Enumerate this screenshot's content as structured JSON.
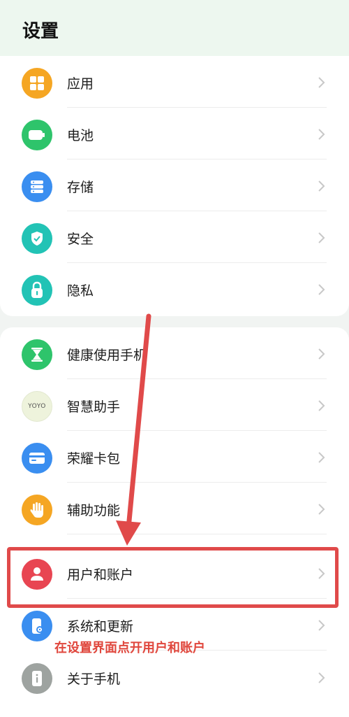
{
  "header": {
    "title": "设置"
  },
  "groups": [
    {
      "items": [
        {
          "label": "应用",
          "icon": "apps-grid-icon",
          "color": "#f5a623"
        },
        {
          "label": "电池",
          "icon": "battery-icon",
          "color": "#2ec46b"
        },
        {
          "label": "存储",
          "icon": "storage-icon",
          "color": "#3a8ef0"
        },
        {
          "label": "安全",
          "icon": "shield-check-icon",
          "color": "#22c3b5"
        },
        {
          "label": "隐私",
          "icon": "privacy-lock-icon",
          "color": "#22c3b5"
        }
      ]
    },
    {
      "items": [
        {
          "label": "健康使用手机",
          "icon": "hourglass-icon",
          "color": "#2ec46b"
        },
        {
          "label": "智慧助手",
          "icon": "yoyo-logo-icon",
          "color": "#eef3dc",
          "icon_text": "YOYO"
        },
        {
          "label": "荣耀卡包",
          "icon": "wallet-card-icon",
          "color": "#3a8ef0"
        },
        {
          "label": "辅助功能",
          "icon": "hand-icon",
          "color": "#f5a623"
        },
        {
          "label": "用户和账户",
          "icon": "user-icon",
          "color": "#e84552"
        },
        {
          "label": "系统和更新",
          "icon": "phone-settings-icon",
          "color": "#3a8ef0"
        },
        {
          "label": "关于手机",
          "icon": "info-phone-icon",
          "color": "#9ea3a0"
        }
      ]
    }
  ],
  "annotation": {
    "text": "在设置界面点开用户和账户",
    "color": "#e0473d"
  },
  "highlight_color": "#e04a4a"
}
